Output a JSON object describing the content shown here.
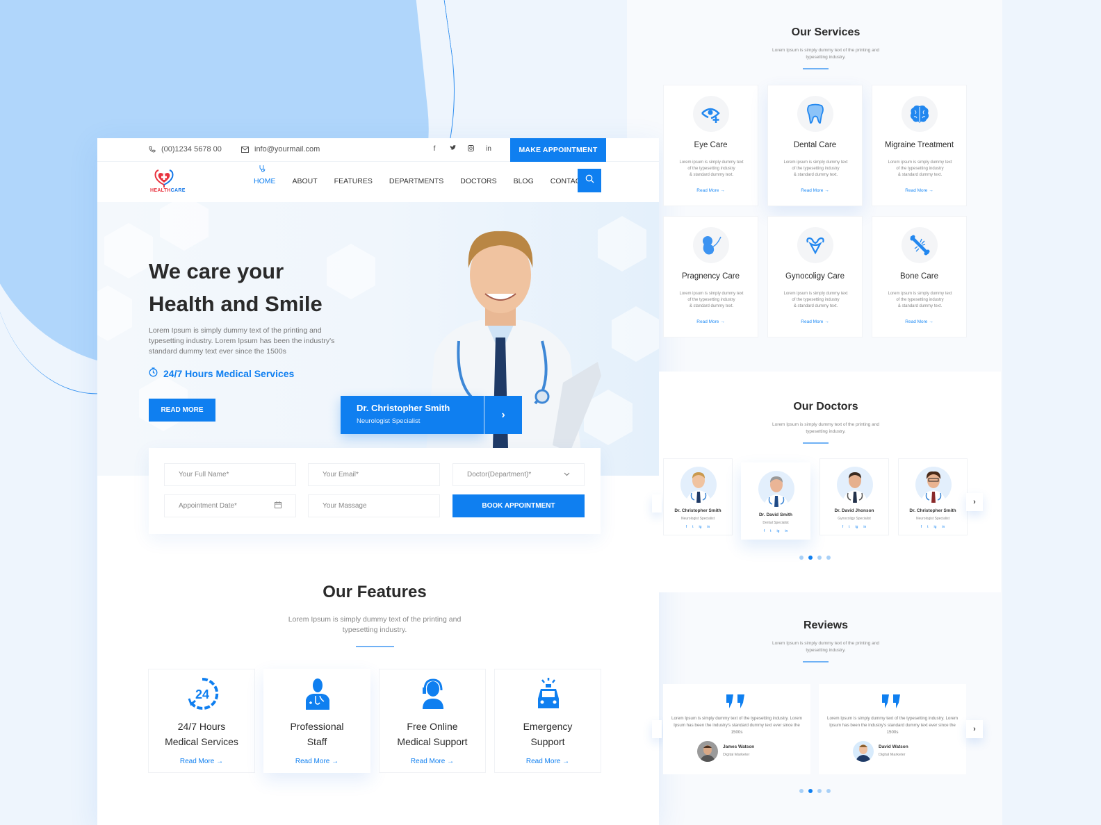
{
  "topbar": {
    "phone": "(00)1234 5678 00",
    "email": "info@yourmail.com",
    "social": [
      "f",
      "t",
      "ig",
      "in"
    ],
    "cta": "MAKE APPOINTMENT"
  },
  "brand": {
    "part1": "HEALTH",
    "part2": "CARE"
  },
  "nav": {
    "items": [
      "HOME",
      "ABOUT",
      "FEATURES",
      "DEPARTMENTS",
      "DOCTORS",
      "BLOG",
      "CONTACT"
    ],
    "active": "HOME"
  },
  "hero": {
    "title_line1": "We care your",
    "title_line2": "Health and Smile",
    "description": "Lorem Ipsum is simply dummy text of the printing and typesetting industry. Lorem Ipsum has been the industry's standard dummy text ever since the 1500s",
    "hours": "24/7 Hours Medical Services",
    "read_more": "READ MORE",
    "doctor_name": "Dr. Christopher Smith",
    "doctor_role": "Neurologist Specialist"
  },
  "appointment_form": {
    "full_name_placeholder": "Your Full Name*",
    "email_placeholder": "Your Email*",
    "department_placeholder": "Doctor(Department)*",
    "date_placeholder": "Appointment Date*",
    "message_placeholder": "Your Massage",
    "submit": "BOOK APPOINTMENT"
  },
  "features": {
    "title": "Our Features",
    "subtitle_line1": "Lorem Ipsum is simply dummy text of the printing and",
    "subtitle_line2": "typesetting industry.",
    "items": [
      {
        "line1": "24/7 Hours",
        "line2": "Medical Services",
        "link": "Read More →",
        "icon": "24-hours-icon"
      },
      {
        "line1": "Professional",
        "line2": "Staff",
        "link": "Read More →",
        "icon": "doctor-icon"
      },
      {
        "line1": "Free Online",
        "line2": "Medical Support",
        "link": "Read More →",
        "icon": "headset-support-icon"
      },
      {
        "line1": "Emergency",
        "line2": "Support",
        "link": "Read More →",
        "icon": "ambulance-icon"
      }
    ]
  },
  "services": {
    "title": "Our Services",
    "subtitle_line1": "Lorem Ipsum is simply dummy text of the printing and",
    "subtitle_line2": "typesetting industry.",
    "desc_line1": "Lorem ipsum is simply dummy text",
    "desc_line2": "of the typesetting industry",
    "desc_line3": "& standard dummy text.",
    "link": "Read More →",
    "items": [
      {
        "title": "Eye Care",
        "icon": "eye-care-icon"
      },
      {
        "title": "Dental Care",
        "icon": "tooth-icon"
      },
      {
        "title": "Migraine Treatment",
        "icon": "brain-icon"
      },
      {
        "title": "Pragnency Care",
        "icon": "fetus-icon"
      },
      {
        "title": "Gynocoligy Care",
        "icon": "uterus-icon"
      },
      {
        "title": "Bone Care",
        "icon": "broken-bone-icon"
      }
    ]
  },
  "doctors": {
    "title": "Our Doctors",
    "subtitle_line1": "Lorem Ipsum is simply dummy text of the printing and",
    "subtitle_line2": "typesetting industry.",
    "items": [
      {
        "name": "Dr. Christopher Smith",
        "role": "Neurologist Specialist"
      },
      {
        "name": "Dr. David Smith",
        "role": "Dental Specialist"
      },
      {
        "name": "Dr. David  Jhonson",
        "role": "Gynocoligy Specialist"
      },
      {
        "name": "Dr. Christopher Smith",
        "role": "Neurologist Specialist"
      }
    ],
    "social": [
      "f",
      "t",
      "ig",
      "in"
    ],
    "active_page": 2,
    "page_count": 4
  },
  "reviews": {
    "title": "Reviews",
    "subtitle_line1": "Lorem Ipsum is simply dummy text of the printing and",
    "subtitle_line2": "typesetting industry.",
    "text": "Lorem Ipsum is simply dummy text of the typesetting industry. Lorem Ipsum has been the industry's standard dummy text ever since the 1500s",
    "items": [
      {
        "name": "James Watson",
        "role": "Digital Marketer"
      },
      {
        "name": "David Watson",
        "role": "Digital Marketer"
      }
    ],
    "active_page": 2,
    "page_count": 4
  },
  "colors": {
    "primary": "#0f7ff0",
    "light_blue": "#b0d6fb",
    "heading": "#2a2a2a",
    "logo_red": "#e8323e"
  }
}
